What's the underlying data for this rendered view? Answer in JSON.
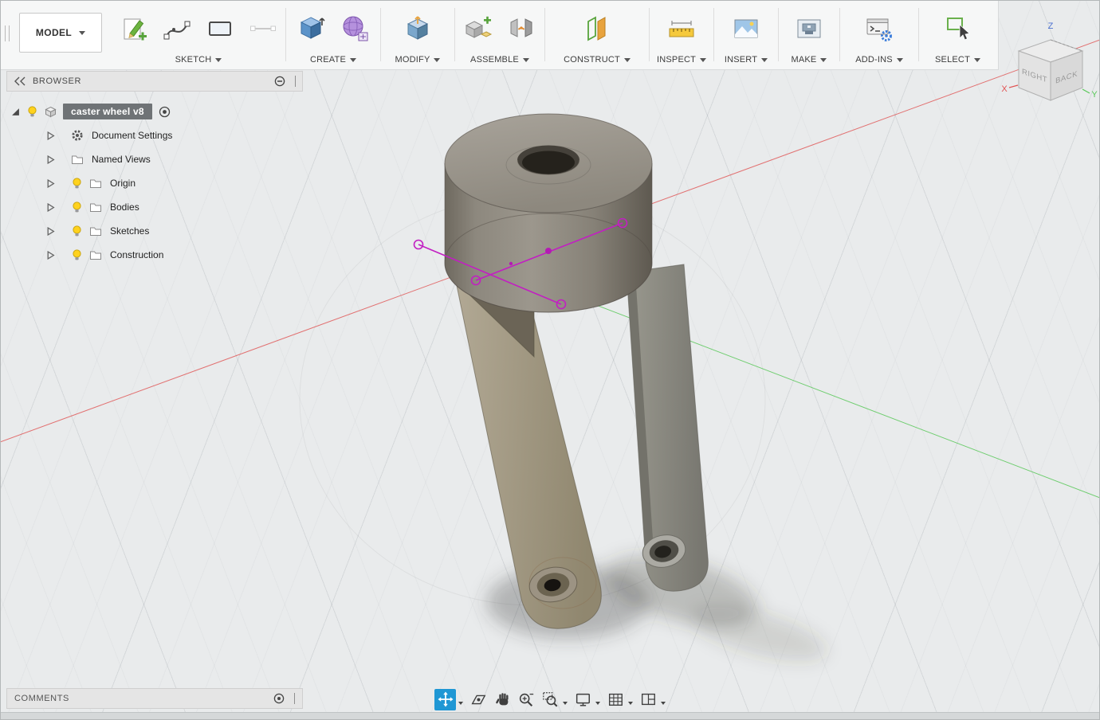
{
  "workspace": {
    "label": "MODEL"
  },
  "ribbon": {
    "groups": [
      {
        "label": "SKETCH"
      },
      {
        "label": "CREATE"
      },
      {
        "label": "MODIFY"
      },
      {
        "label": "ASSEMBLE"
      },
      {
        "label": "CONSTRUCT"
      },
      {
        "label": "INSPECT"
      },
      {
        "label": "INSERT"
      },
      {
        "label": "MAKE"
      },
      {
        "label": "ADD-INS"
      },
      {
        "label": "SELECT"
      }
    ]
  },
  "browser": {
    "title": "BROWSER",
    "root_item": {
      "label": "caster wheel v8"
    },
    "items": [
      {
        "label": "Document Settings",
        "icon": "gear-icon",
        "has_bulb": false
      },
      {
        "label": "Named Views",
        "icon": "folder-icon",
        "has_bulb": false
      },
      {
        "label": "Origin",
        "icon": "folder-icon",
        "has_bulb": true
      },
      {
        "label": "Bodies",
        "icon": "folder-icon",
        "has_bulb": true
      },
      {
        "label": "Sketches",
        "icon": "folder-icon",
        "has_bulb": true
      },
      {
        "label": "Construction",
        "icon": "folder-icon",
        "has_bulb": true
      }
    ]
  },
  "viewcube": {
    "face_right": "RIGHT",
    "face_back": "BACK",
    "axis_x": "X",
    "axis_y": "Y",
    "axis_z": "Z"
  },
  "comments": {
    "title": "COMMENTS"
  },
  "colors": {
    "accent_blue": "#1f97d4",
    "sketch_magenta": "#c21fc2",
    "axis_x_red": "#e05252",
    "axis_y_green": "#58c858",
    "model_tan": "#a39a88",
    "model_grey": "#8e8d87"
  },
  "icons": {
    "ribbon": [
      "create-sketch-icon",
      "spline-icon",
      "rectangle-icon",
      "line-disabled-icon",
      "box-icon",
      "create-form-icon",
      "press-pull-icon",
      "new-component-icon",
      "joint-icon",
      "construction-plane-icon",
      "measure-icon",
      "canvas-icon",
      "make-icon",
      "scripts-addins-icon",
      "select-window-icon"
    ],
    "navbar": [
      "move-pan-icon",
      "look-at-icon",
      "pan-hand-icon",
      "zoom-icon",
      "zoom-window-icon",
      "display-settings-icon",
      "grid-snap-icon",
      "viewports-icon"
    ]
  }
}
